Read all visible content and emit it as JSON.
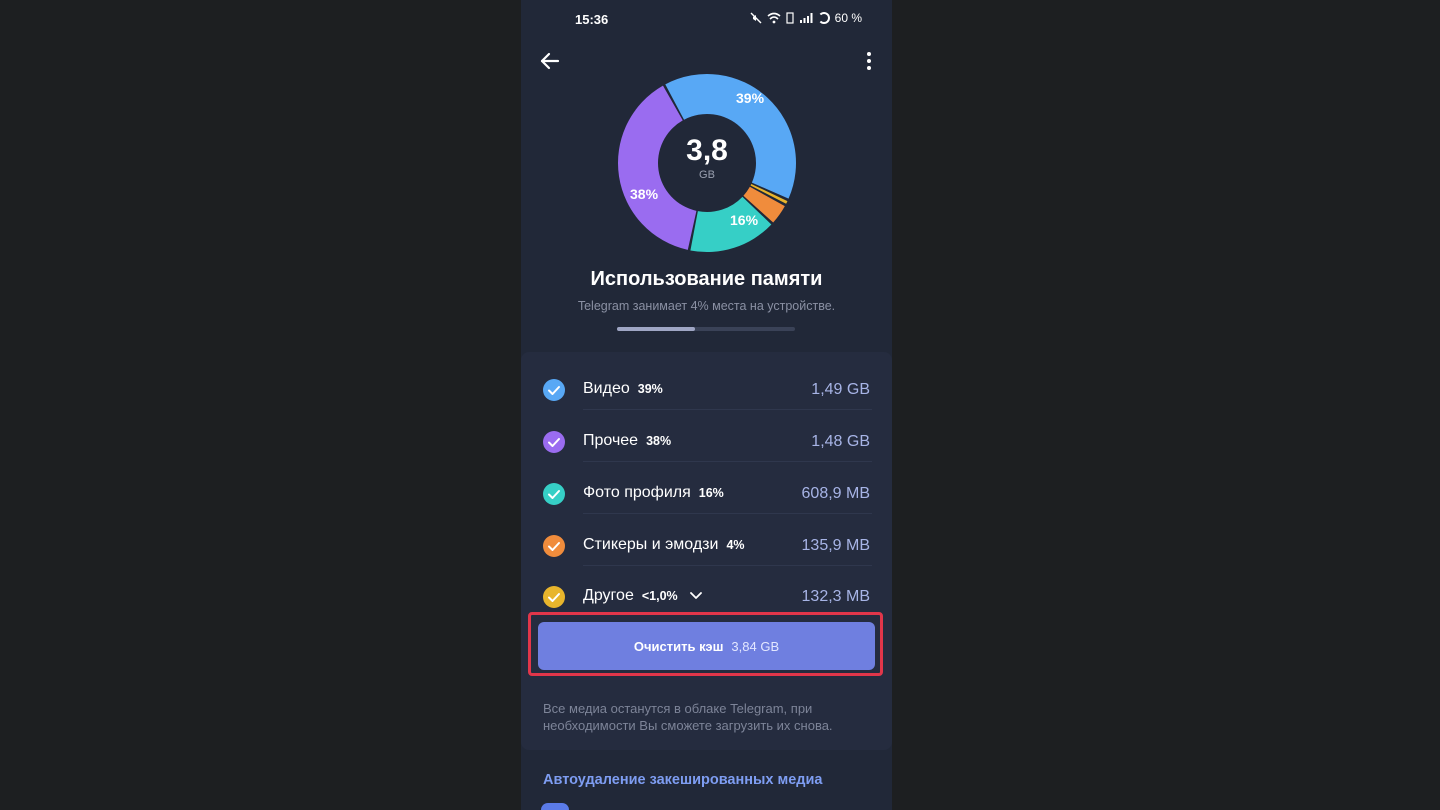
{
  "status": {
    "time": "15:36",
    "battery": "60 %"
  },
  "storage": {
    "total_value": "3,8",
    "total_unit": "GB",
    "title": "Использование памяти",
    "subtitle": "Telegram занимает 4% места на устройстве.",
    "device_usage_fraction": 0.44
  },
  "chart_data": {
    "type": "pie",
    "center_label": "3,8 GB",
    "labels": [
      "Видео",
      "Прочее",
      "Фото профиля",
      "Стикеры и эмодзи",
      "Другое"
    ],
    "values": [
      39,
      38,
      16,
      4,
      1
    ],
    "visible_slice_labels": [
      "39%",
      "38%",
      "16%"
    ],
    "colors": [
      "#58a8f5",
      "#9a6cf0",
      "#36cfc6",
      "#f08c3c",
      "#e8b52c"
    ]
  },
  "items": [
    {
      "label": "Видео",
      "pct": "39%",
      "size": "1,49 GB",
      "color": "#58a8f5"
    },
    {
      "label": "Прочее",
      "pct": "38%",
      "size": "1,48 GB",
      "color": "#9a6cf0"
    },
    {
      "label": "Фото профиля",
      "pct": "16%",
      "size": "608,9 MB",
      "color": "#36cfc6"
    },
    {
      "label": "Стикеры и эмодзи",
      "pct": "4%",
      "size": "135,9 MB",
      "color": "#f08c3c"
    },
    {
      "label": "Другое",
      "pct": "<1,0%",
      "size": "132,3 MB",
      "color": "#e8b52c"
    }
  ],
  "clear_button": {
    "label": "Очистить кэш",
    "amount": "3,84 GB"
  },
  "info": "Все медиа останутся в облаке Telegram, при необходимости Вы сможете загрузить их снова.",
  "auto_delete": {
    "title": "Автоудаление закешированных медиа"
  },
  "icons": {
    "back": "arrow-left-icon",
    "more": "more-vertical-icon",
    "check": "check-circle-icon",
    "chevron": "chevron-down-icon"
  }
}
